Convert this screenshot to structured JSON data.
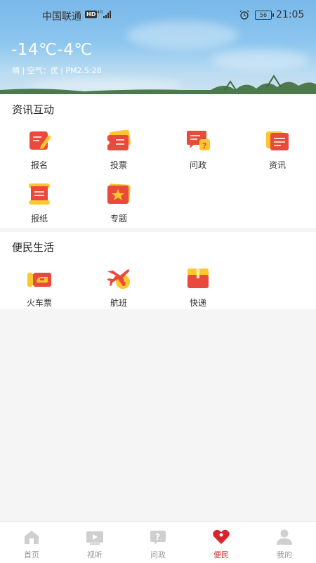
{
  "status_bar": {
    "carrier": "中国联通",
    "hd_badge": "HD",
    "battery": "56",
    "time": "21:05"
  },
  "weather": {
    "temperature": "-14℃-4℃",
    "detail": "晴 | 空气：优 | PM2.5:28"
  },
  "news_section": {
    "title": "资讯互动",
    "items": [
      {
        "label": "报名",
        "icon": "signup-icon"
      },
      {
        "label": "投票",
        "icon": "vote-icon"
      },
      {
        "label": "问政",
        "icon": "inquiry-icon"
      },
      {
        "label": "资讯",
        "icon": "news-icon"
      },
      {
        "label": "报纸",
        "icon": "newspaper-icon"
      },
      {
        "label": "专题",
        "icon": "topic-icon"
      }
    ]
  },
  "life_section": {
    "title": "便民生活",
    "items": [
      {
        "label": "火车票",
        "icon": "train-ticket-icon"
      },
      {
        "label": "航班",
        "icon": "flight-icon"
      },
      {
        "label": "快递",
        "icon": "express-icon"
      }
    ]
  },
  "tabbar": {
    "active": "便民",
    "items": [
      {
        "label": "首页",
        "icon": "home-icon"
      },
      {
        "label": "视听",
        "icon": "video-icon"
      },
      {
        "label": "问政",
        "icon": "inquiry-icon"
      },
      {
        "label": "便民",
        "icon": "heart-icon"
      },
      {
        "label": "我的",
        "icon": "user-icon"
      }
    ]
  },
  "colors": {
    "accent": "#d8262e",
    "icon_red": "#e84a3c",
    "icon_yellow": "#ffc72c",
    "inactive": "#bbbbbb"
  }
}
